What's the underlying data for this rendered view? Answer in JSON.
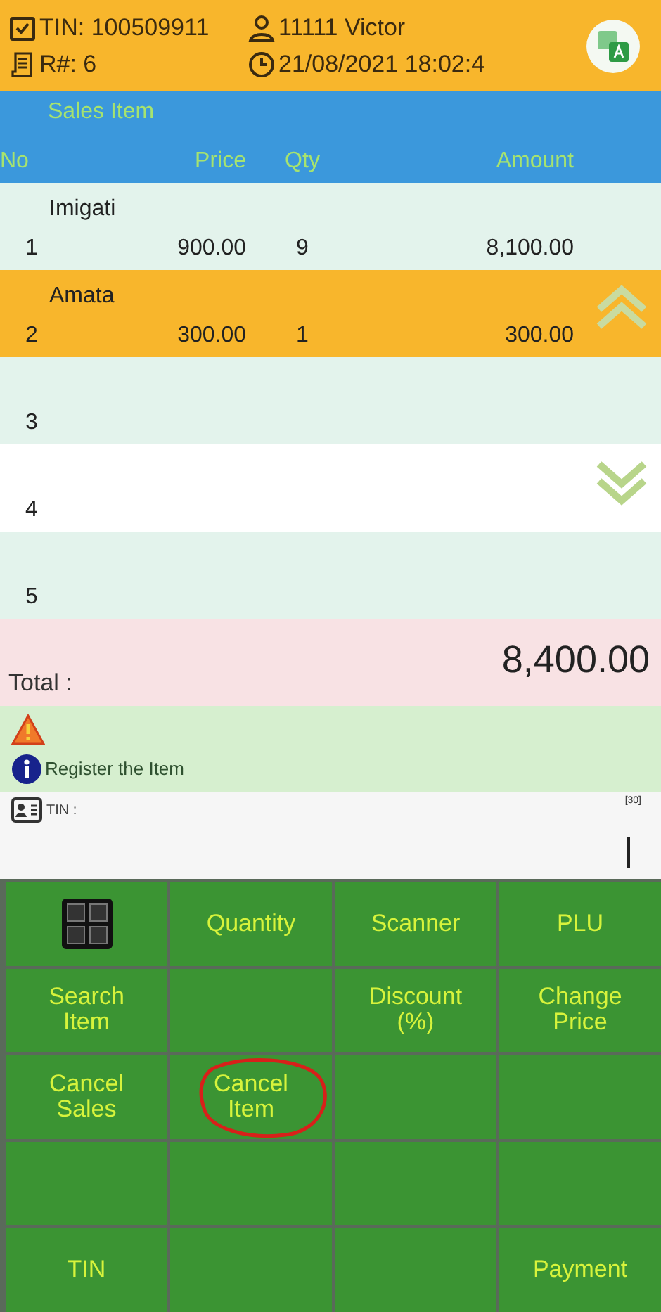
{
  "header": {
    "tin": "TIN: 100509911",
    "user": "11111 Victor",
    "receipt": "R#: 6",
    "datetime": "21/08/2021 18:02:4"
  },
  "sales": {
    "title": "Sales Item",
    "columns": [
      "No",
      "Price",
      "Qty",
      "Amount"
    ],
    "rows": [
      {
        "name": "Imigati",
        "no": "1",
        "price": "900.00",
        "qty": "9",
        "amount": "8,100.00",
        "selected": false
      },
      {
        "name": "Amata",
        "no": "2",
        "price": "300.00",
        "qty": "1",
        "amount": "300.00",
        "selected": true
      },
      {
        "no": "3",
        "selected": false
      },
      {
        "no": "4",
        "selected": false
      },
      {
        "no": "5",
        "selected": false
      }
    ]
  },
  "total": {
    "label": "Total :",
    "value": "8,400.00"
  },
  "message": {
    "text": "Register the Item"
  },
  "tin_field": {
    "label": "TIN :",
    "counter": "[30]"
  },
  "keypad": [
    {
      "kind": "icon",
      "annotated": false
    },
    {
      "kind": "text",
      "label": "Quantity",
      "annotated": false
    },
    {
      "kind": "text",
      "label": "Scanner",
      "annotated": false
    },
    {
      "kind": "text",
      "label": "PLU",
      "annotated": false
    },
    {
      "kind": "text",
      "label": "Search\nItem",
      "annotated": false
    },
    {
      "kind": "empty",
      "annotated": false
    },
    {
      "kind": "text",
      "label": "Discount\n(%)",
      "annotated": false
    },
    {
      "kind": "text",
      "label": "Change\nPrice",
      "annotated": false
    },
    {
      "kind": "text",
      "label": "Cancel\nSales",
      "annotated": false
    },
    {
      "kind": "text",
      "label": "Cancel\nItem",
      "annotated": true
    },
    {
      "kind": "empty",
      "annotated": false
    },
    {
      "kind": "empty",
      "annotated": false
    },
    {
      "kind": "empty",
      "annotated": false
    },
    {
      "kind": "empty",
      "annotated": false
    },
    {
      "kind": "empty",
      "annotated": false
    },
    {
      "kind": "empty",
      "annotated": false
    },
    {
      "kind": "text",
      "label": "TIN",
      "annotated": false
    },
    {
      "kind": "empty",
      "annotated": false
    },
    {
      "kind": "empty",
      "annotated": false
    },
    {
      "kind": "text",
      "label": "Payment",
      "annotated": false
    }
  ]
}
